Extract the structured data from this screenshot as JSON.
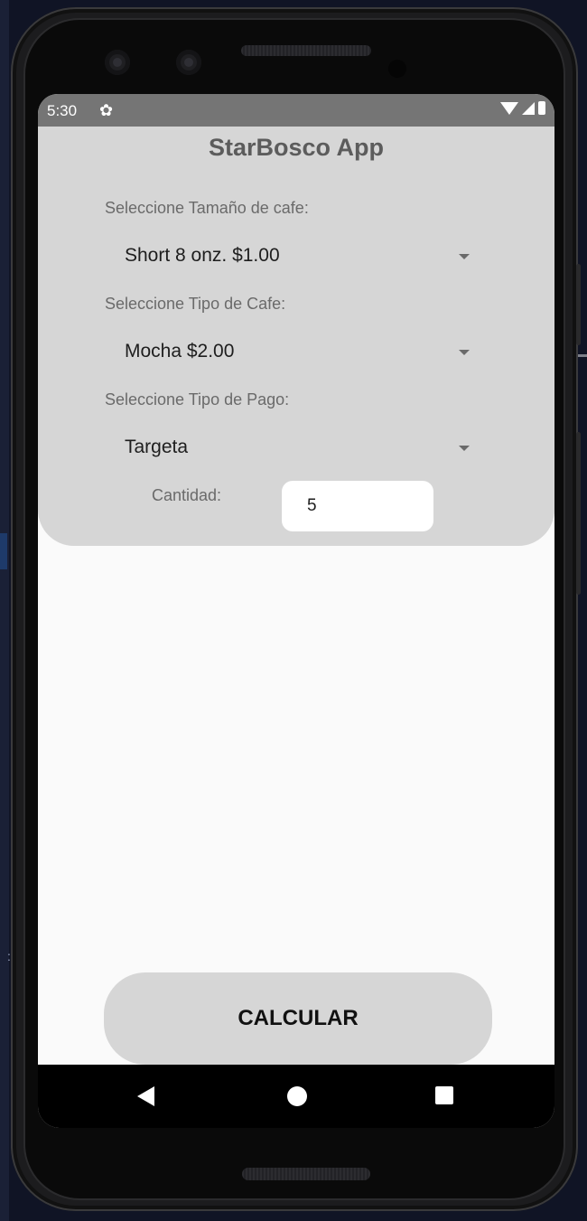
{
  "status_bar": {
    "time": "5:30",
    "settings_icon": "gear-icon",
    "wifi_icon": "wifi-icon",
    "signal_icon": "signal-icon",
    "battery_icon": "battery-icon"
  },
  "app": {
    "title": "StarBosco App",
    "size_label": "Seleccione Tamaño de cafe:",
    "size_value": "Short 8 onz. $1.00",
    "type_label": "Seleccione Tipo de Cafe:",
    "type_value": "Mocha $2.00",
    "payment_label": "Seleccione Tipo de Pago:",
    "payment_value": "Targeta",
    "quantity_label": "Cantidad:",
    "quantity_value": "5",
    "calculate_button": "CALCULAR"
  },
  "nav_bar": {
    "back_icon": "back-triangle-icon",
    "home_icon": "home-circle-icon",
    "recents_icon": "recents-square-icon"
  },
  "colors": {
    "card_background": "#d6d6d6",
    "screen_background": "#fafafa",
    "status_bar": "#757575",
    "nav_bar": "#000000"
  }
}
